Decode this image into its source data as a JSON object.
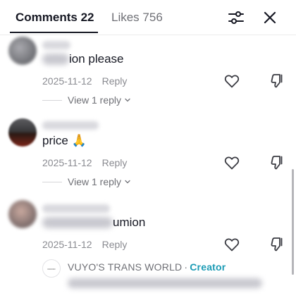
{
  "header": {
    "comments_tab": "Comments 22",
    "likes_tab": "Likes 756",
    "filter_icon": "filter-sliders-icon",
    "close_icon": "close-icon"
  },
  "comments": [
    {
      "text": "ion please",
      "date": "2025-11-12",
      "reply_label": "Reply",
      "view_replies": "View 1 reply"
    },
    {
      "text": "price 🙏",
      "date": "2025-11-12",
      "reply_label": "Reply",
      "view_replies": "View 1 reply"
    },
    {
      "text": "umion",
      "date": "2025-11-12",
      "reply_label": "Reply",
      "reply_preview": {
        "author": "VUYO'S TRANS WORLD",
        "separator": "·",
        "badge": "Creator"
      }
    }
  ],
  "colors": {
    "text": "#161823",
    "muted": "#8a8b91",
    "creator_badge": "#1b9bb5"
  }
}
